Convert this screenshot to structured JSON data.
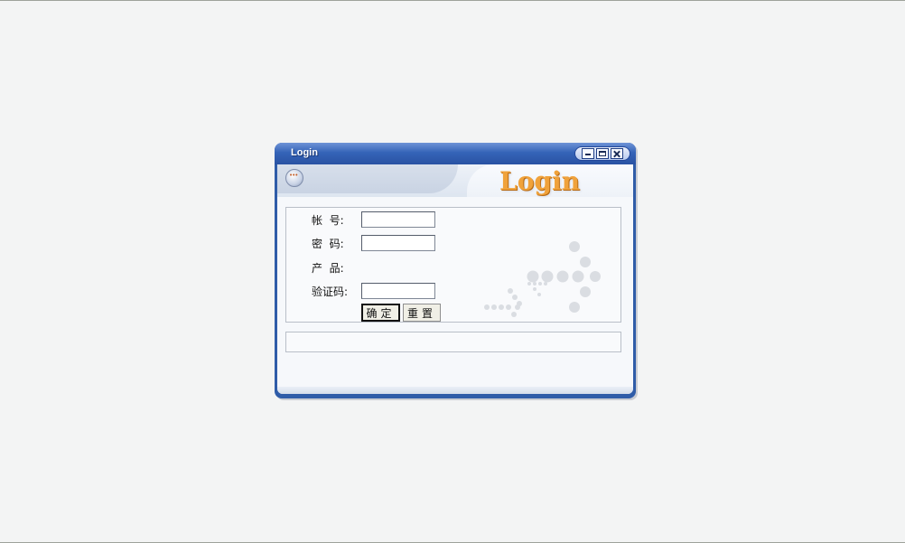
{
  "window": {
    "title": "Login",
    "controls": [
      "minimize",
      "maximize",
      "close"
    ]
  },
  "banner": {
    "logo_text": "Login",
    "logo_color": "#f0a23b",
    "icon": "orb-icon"
  },
  "form": {
    "account_label": "帐  号:",
    "account_value": "",
    "password_label": "密  码:",
    "password_value": "",
    "product_label": "产  品:",
    "captcha_label": "验证码:",
    "captcha_value": "",
    "ok_label": "确定",
    "reset_label": "重置"
  },
  "status": {
    "text": ""
  },
  "colors": {
    "background": "#f3f4f4",
    "window_frame": "#2f5ca8",
    "titlebar_top": "#6e93d6",
    "titlebar_bottom": "#2952a3"
  }
}
